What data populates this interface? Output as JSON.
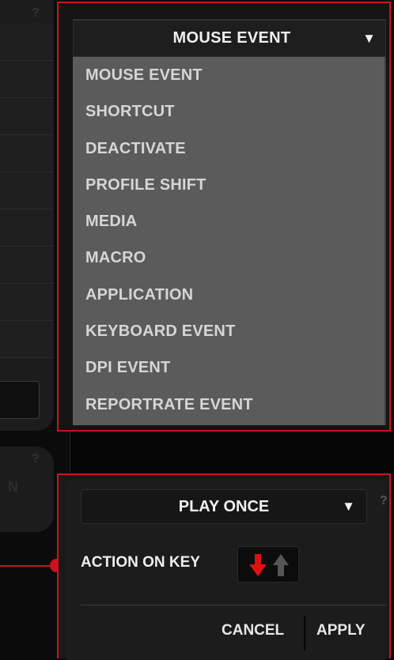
{
  "event_dropdown": {
    "selected": "MOUSE EVENT",
    "options": [
      "MOUSE EVENT",
      "SHORTCUT",
      "DEACTIVATE",
      "PROFILE SHIFT",
      "MEDIA",
      "MACRO",
      "APPLICATION",
      "KEYBOARD EVENT",
      "DPI EVENT",
      "REPORTRATE EVENT"
    ]
  },
  "left_panel": {
    "help_top": "?",
    "help_mid": "?",
    "partial_letter": "N"
  },
  "play_mode": {
    "selected": "PLAY ONCE",
    "help": "?"
  },
  "action_on_key": {
    "label": "ACTION ON KEY",
    "active_direction": "down"
  },
  "buttons": {
    "cancel": "CANCEL",
    "apply": "APPLY"
  },
  "icons": {
    "dropdown_arrow": "▼",
    "key_down": "arrow-down-icon",
    "key_up": "arrow-up-icon"
  },
  "colors": {
    "accent": "#d0101e",
    "list_bg": "#5b5b5b",
    "panel_bg": "#1c1c1c",
    "inactive_arrow": "#555555"
  }
}
